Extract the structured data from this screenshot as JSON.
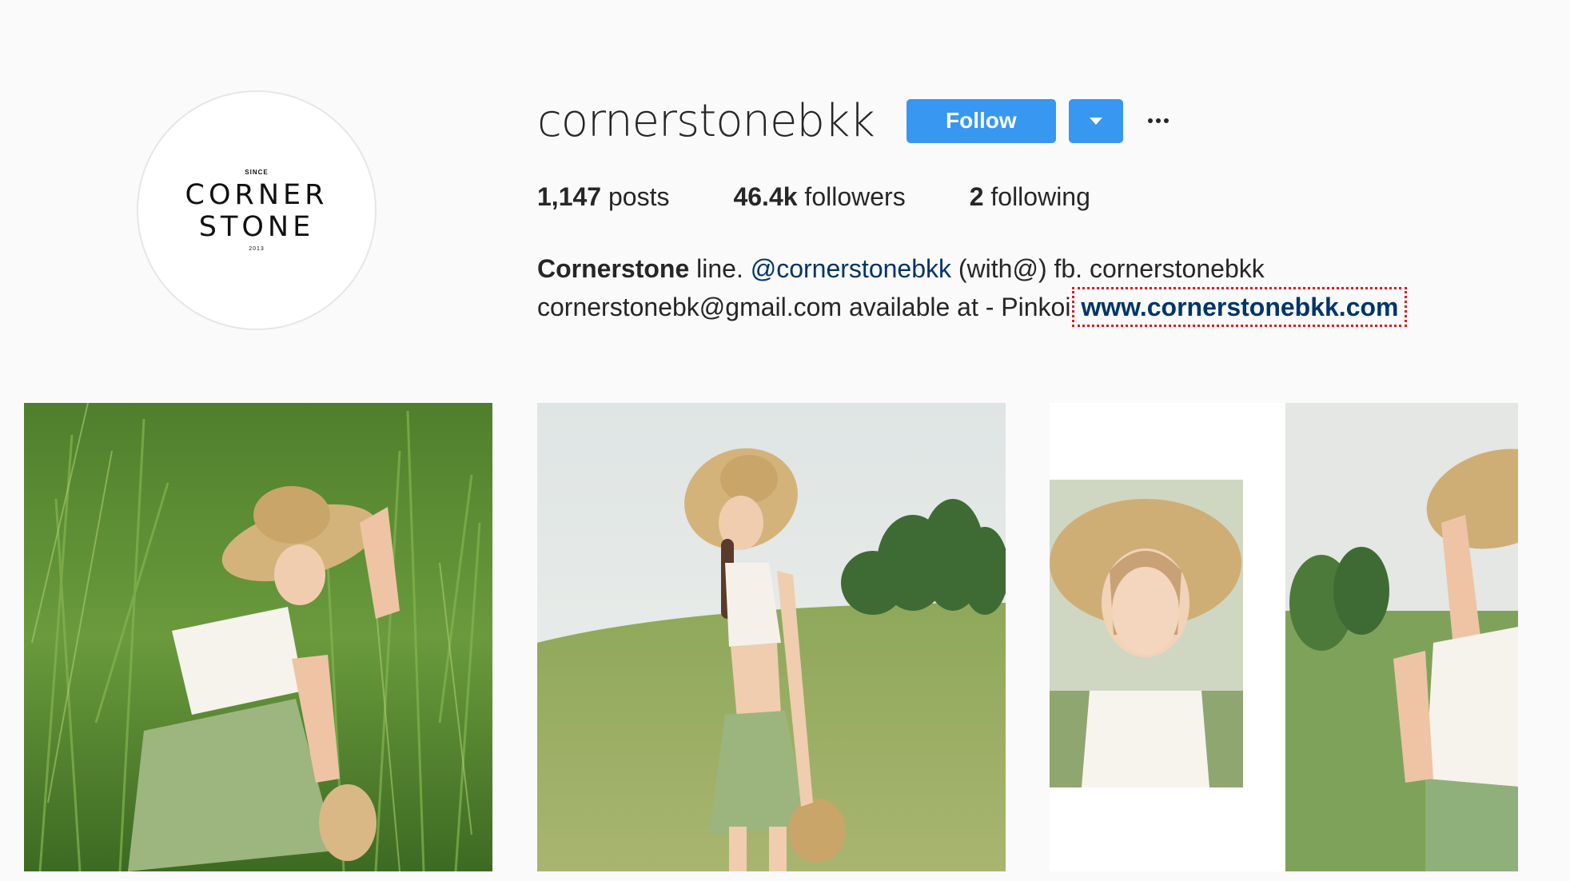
{
  "profile": {
    "avatar": {
      "since": "SINCE",
      "line1": "CORNER",
      "line2": "STONE",
      "year": "2013"
    },
    "username": "cornerstonebkk",
    "follow_label": "Follow",
    "dropdown_icon": "triangle-down-icon",
    "more_icon": "ellipsis-icon"
  },
  "stats": {
    "posts_count": "1,147",
    "posts_label": "posts",
    "followers_count": "46.4k",
    "followers_label": "followers",
    "following_count": "2",
    "following_label": "following"
  },
  "bio": {
    "name": "Cornerstone",
    "line1_a": " line. ",
    "mention": "@cornerstonebkk",
    "line1_b": " (with@) fb. cornerstonebkk",
    "line2": "cornerstonebk@gmail.com available at - Pinkoi ",
    "website": "www.cornerstonebkk.com"
  },
  "colors": {
    "accent": "#3897f0",
    "link": "#003569",
    "highlight_box": "#e0181f",
    "background": "#fafafa"
  },
  "posts": [
    {
      "icon": "photo-woman-crouching-in-grass"
    },
    {
      "icon": "photo-woman-standing-in-field"
    },
    {
      "icon": "photo-collage-woman-with-hat"
    }
  ]
}
